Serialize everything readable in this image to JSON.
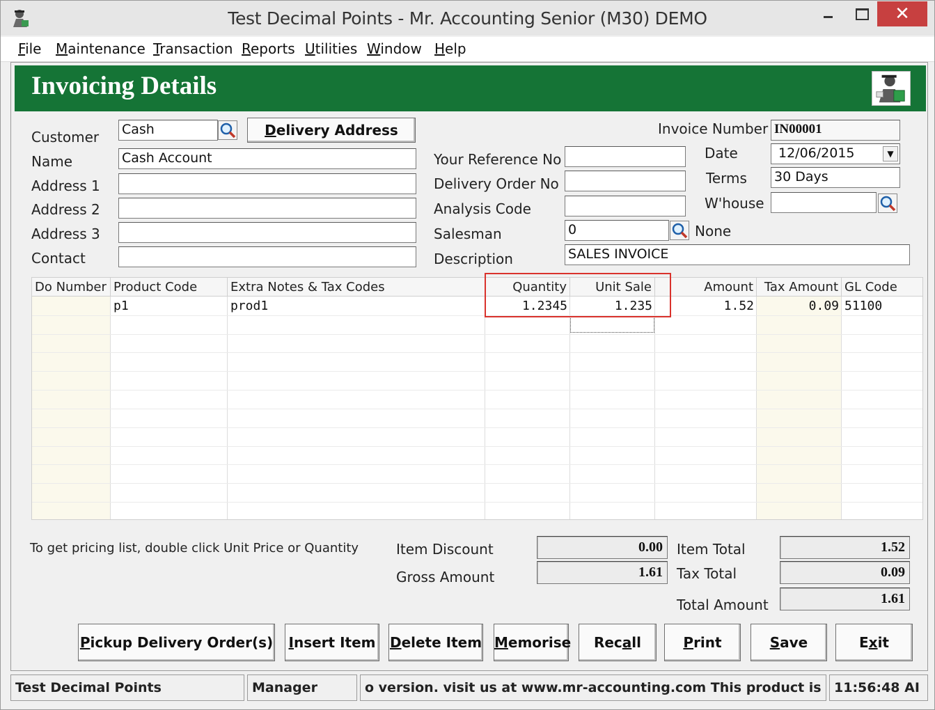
{
  "window": {
    "title": "Test Decimal Points - Mr. Accounting Senior (M30) DEMO",
    "close_glyph": "✕"
  },
  "menu": {
    "items": [
      {
        "first": "F",
        "rest": "ile"
      },
      {
        "first": "M",
        "rest": "aintenance"
      },
      {
        "first": "T",
        "rest": "ransaction"
      },
      {
        "first": "R",
        "rest": "eports"
      },
      {
        "first": "U",
        "rest": "tilities"
      },
      {
        "first": "W",
        "rest": "indow"
      },
      {
        "first": "H",
        "rest": "elp"
      }
    ]
  },
  "header": {
    "title": "Invoicing Details",
    "accent_color": "#157436"
  },
  "customer": {
    "labels": {
      "customer": "Customer",
      "name": "Name",
      "address1": "Address 1",
      "address2": "Address 2",
      "address3": "Address 3",
      "contact": "Contact"
    },
    "values": {
      "customer": "Cash",
      "name": "Cash Account",
      "address1": "",
      "address2": "",
      "address3": "",
      "contact": ""
    },
    "delivery_button": {
      "first": "D",
      "rest": "elivery Address"
    }
  },
  "reference": {
    "labels": {
      "your_ref": "Your Reference No",
      "delivery_order": "Delivery Order No",
      "analysis_code": "Analysis Code",
      "salesman": "Salesman",
      "description": "Description"
    },
    "values": {
      "your_ref": "",
      "delivery_order": "",
      "analysis_code": "",
      "salesman": "0",
      "salesman_name": "None",
      "description": "SALES INVOICE"
    }
  },
  "invoice": {
    "labels": {
      "number": "Invoice Number",
      "date": "Date",
      "terms": "Terms",
      "warehouse": "W'house"
    },
    "values": {
      "number": "IN00001",
      "date": "12/06/2015",
      "terms": "30 Days",
      "warehouse": ""
    }
  },
  "grid": {
    "columns": [
      "Do Number",
      "Product Code",
      "Extra Notes & Tax Codes",
      "Quantity",
      "Unit Sale",
      "Amount",
      "Tax Amount",
      "GL Code"
    ],
    "rows": [
      {
        "do_number": "",
        "product_code": "p1",
        "notes": "prod1",
        "quantity": "1.2345",
        "unit_sale": "1.235",
        "amount": "1.52",
        "tax_amount": "0.09",
        "gl_code": "51100"
      }
    ]
  },
  "hint": "To get pricing list, double click Unit Price or Quantity",
  "totals": {
    "labels": {
      "item_discount": "Item Discount",
      "gross_amount": "Gross Amount",
      "item_total": "Item Total",
      "tax_total": "Tax Total",
      "total_amount": "Total Amount"
    },
    "values": {
      "item_discount": "0.00",
      "gross_amount": "1.61",
      "item_total": "1.52",
      "tax_total": "0.09",
      "total_amount": "1.61"
    }
  },
  "buttons": {
    "pickup": {
      "first": "P",
      "rest": "ickup Delivery Order(s)"
    },
    "insert": {
      "first": "I",
      "rest": "nsert Item"
    },
    "delete": {
      "first": "D",
      "rest": "elete Item"
    },
    "memorise": {
      "first": "M",
      "rest": "emorise"
    },
    "recall": {
      "before": "Rec",
      "ul": "a",
      "after": "ll"
    },
    "print": {
      "first": "P",
      "rest": "rint"
    },
    "save": {
      "first": "S",
      "rest": "ave"
    },
    "exit": {
      "before": "E",
      "ul": "x",
      "after": "it"
    }
  },
  "status": {
    "company": "Test Decimal Points",
    "user": "Manager",
    "message": "o version.  visit us at www.mr-accounting.com This product is dem",
    "time": "11:56:48 AI"
  }
}
